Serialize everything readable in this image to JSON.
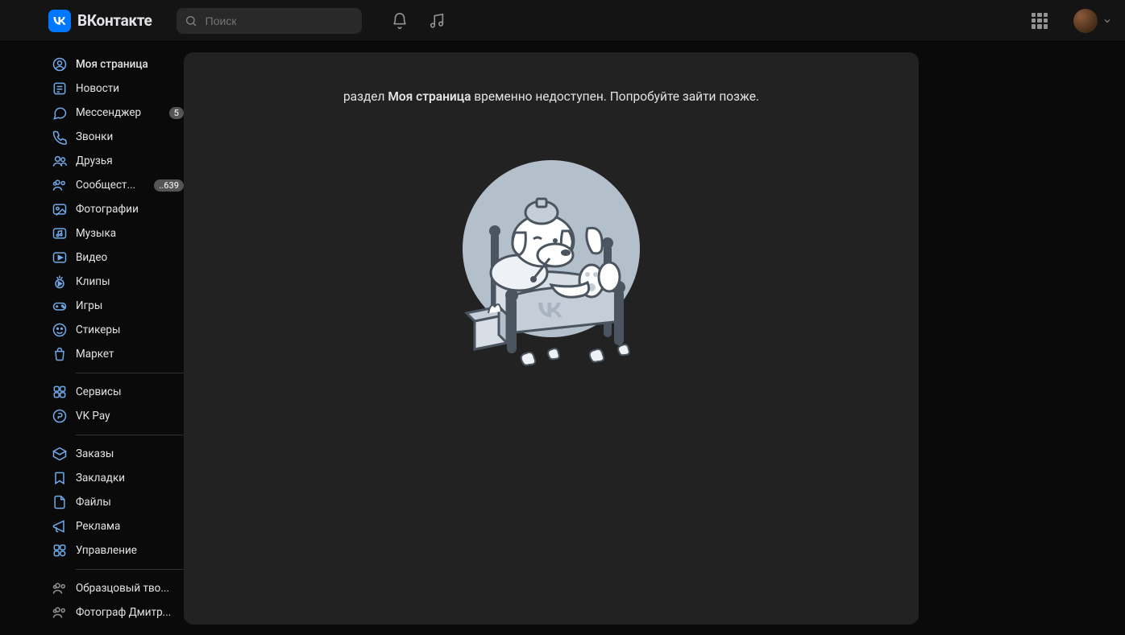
{
  "header": {
    "logo_text": "ВКонтакте",
    "search_placeholder": "Поиск"
  },
  "sidebar": {
    "group1": [
      {
        "label": "Моя страница",
        "icon": "user-circle",
        "active": true
      },
      {
        "label": "Новости",
        "icon": "news"
      },
      {
        "label": "Мессенджер",
        "icon": "chat",
        "badge": "5"
      },
      {
        "label": "Звонки",
        "icon": "phone"
      },
      {
        "label": "Друзья",
        "icon": "friends"
      },
      {
        "label": "Сообщест...",
        "icon": "community",
        "badge": "..639"
      },
      {
        "label": "Фотографии",
        "icon": "photo"
      },
      {
        "label": "Музыка",
        "icon": "music"
      },
      {
        "label": "Видео",
        "icon": "video"
      },
      {
        "label": "Клипы",
        "icon": "clips"
      },
      {
        "label": "Игры",
        "icon": "games"
      },
      {
        "label": "Стикеры",
        "icon": "stickers"
      },
      {
        "label": "Маркет",
        "icon": "market"
      }
    ],
    "group2": [
      {
        "label": "Сервисы",
        "icon": "services"
      },
      {
        "label": "VK Pay",
        "icon": "pay"
      }
    ],
    "group3": [
      {
        "label": "Заказы",
        "icon": "orders"
      },
      {
        "label": "Закладки",
        "icon": "bookmarks"
      },
      {
        "label": "Файлы",
        "icon": "files"
      },
      {
        "label": "Реклама",
        "icon": "ads"
      },
      {
        "label": "Управление",
        "icon": "manage"
      }
    ],
    "group4": [
      {
        "label": "Образцовый тво...",
        "icon": "community"
      },
      {
        "label": "Фотограф Дмитр...",
        "icon": "community"
      }
    ]
  },
  "main": {
    "msg_prefix": "раздел ",
    "msg_bold": "Моя страница",
    "msg_suffix": " временно недоступен. Попробуйте зайти позже."
  }
}
